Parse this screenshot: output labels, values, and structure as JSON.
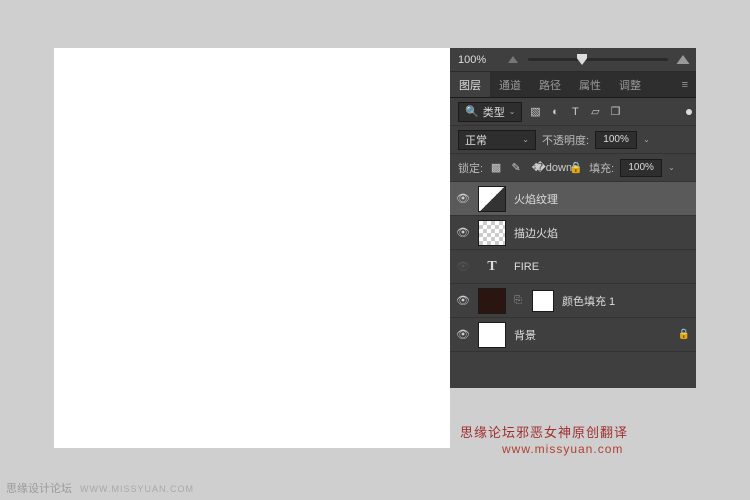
{
  "zoom": {
    "value": "100%"
  },
  "tabs": [
    "图层",
    "通道",
    "路径",
    "属性",
    "调整"
  ],
  "filter": {
    "label": "类型",
    "icons": [
      "image",
      "circle",
      "T",
      "shape",
      "fx"
    ]
  },
  "blend": {
    "mode": "正常",
    "opacity_label": "不透明度:",
    "opacity": "100%"
  },
  "lock": {
    "label": "锁定:",
    "fill_label": "填充:",
    "fill": "100%"
  },
  "layers": [
    {
      "name": "火焰纹理",
      "visible": true,
      "thumb": "fx",
      "selected": true
    },
    {
      "name": "描边火焰",
      "visible": true,
      "thumb": "trans"
    },
    {
      "name": "FIRE",
      "visible": false,
      "thumb": "T"
    },
    {
      "name": "颜色填充 1",
      "visible": true,
      "thumb": "dark",
      "linked": true,
      "mask": true
    },
    {
      "name": "背景",
      "visible": true,
      "thumb": "white",
      "locked": true
    }
  ],
  "watermark": {
    "line1": "思缘论坛邪恶女神原创翻译",
    "line2": "www.missyuan.com"
  },
  "footer": {
    "name": "思缘设计论坛",
    "url": "WWW.MISSYUAN.COM"
  }
}
